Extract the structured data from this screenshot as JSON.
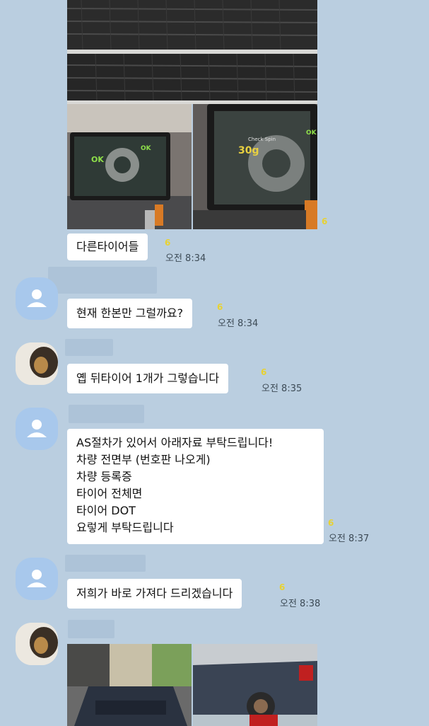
{
  "colors": {
    "background": "#bacee0",
    "bubble": "#ffffff",
    "unread": "#e8d233",
    "timestamp": "#3d4b56",
    "avatar_default": "#a8c8ec"
  },
  "messages": [
    {
      "unread": "6",
      "time": ""
    },
    {
      "text": "다른타이어들",
      "unread": "6",
      "time": "오전 8:34"
    },
    {
      "text": "현재 한본만 그럴까요?",
      "unread": "6",
      "time": "오전 8:34"
    },
    {
      "text": "옙 뒤타이어 1개가 그렇습니다",
      "unread": "6",
      "time": "오전 8:35"
    },
    {
      "lines": [
        "AS절차가 있어서 아래자료 부탁드립니다!",
        "차량 전면부 (번호판 나오게)",
        "차량 등록증",
        "타이어 전체면",
        "타이어 DOT",
        "요렇게 부탁드립니다"
      ],
      "unread": "6",
      "time": "오전 8:37"
    },
    {
      "text": "저희가 바로 가져다 드리겠습니다",
      "unread": "6",
      "time": "오전 8:38"
    }
  ],
  "photos": {
    "machine_left_status": "OK",
    "machine_left_status2": "OK",
    "machine_right_label": "Check Spin",
    "machine_right_value": "30g",
    "machine_right_status": "OK"
  }
}
